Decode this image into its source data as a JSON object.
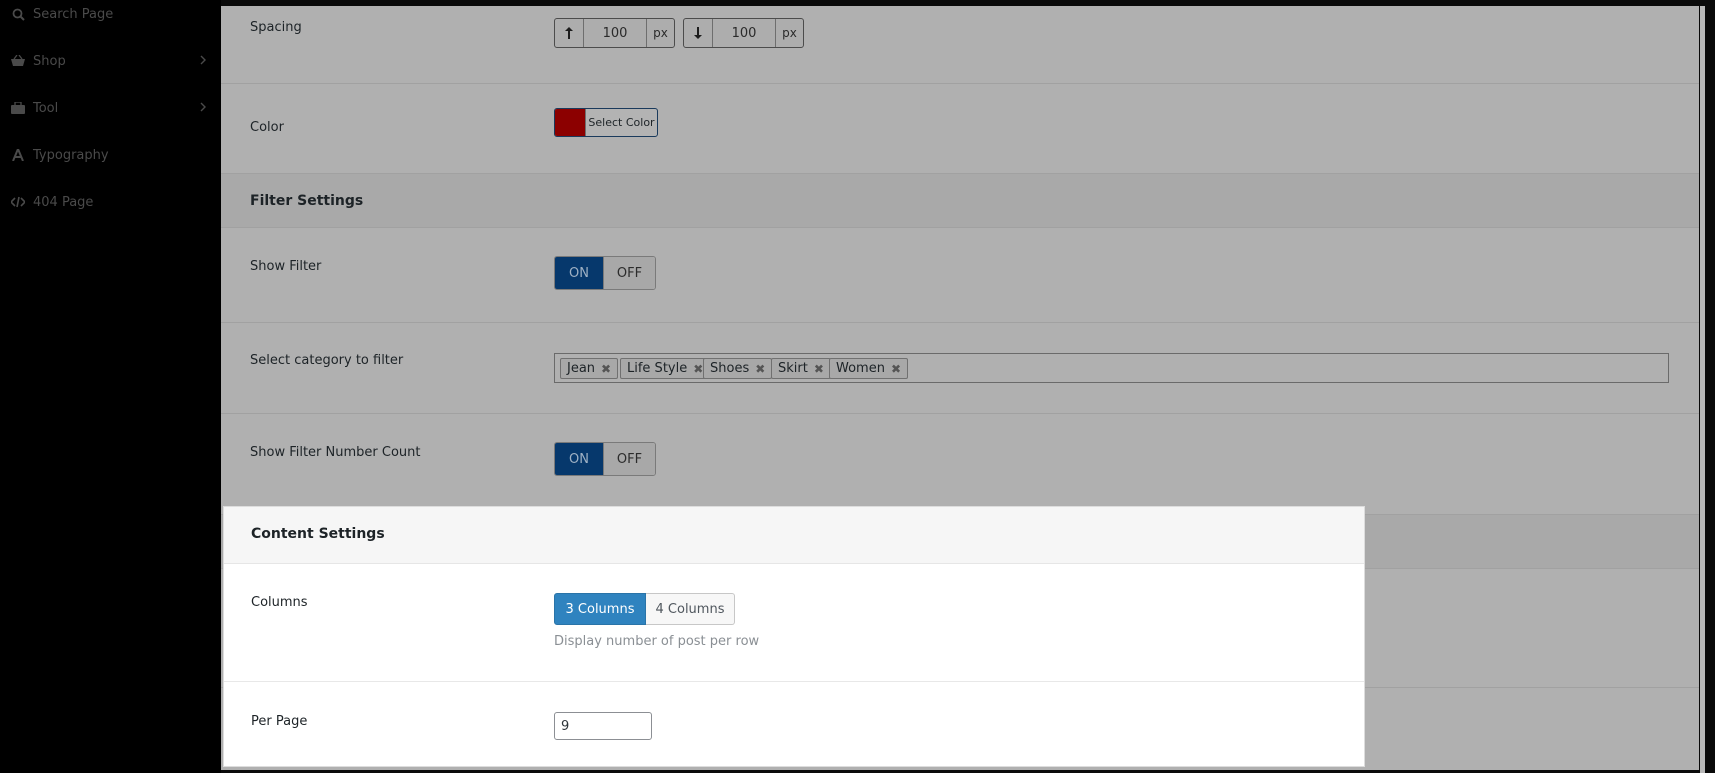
{
  "sidebar": {
    "items": [
      {
        "label": "Search Page",
        "icon": "search-icon"
      },
      {
        "label": "Shop",
        "icon": "basket-icon",
        "has_submenu": true
      },
      {
        "label": "Tool",
        "icon": "toolbox-icon",
        "has_submenu": true
      },
      {
        "label": "Typography",
        "icon": "typography-icon"
      },
      {
        "label": "404 Page",
        "icon": "code-icon"
      }
    ]
  },
  "settings": {
    "spacing": {
      "label": "Spacing",
      "top_value": "100",
      "bottom_value": "100",
      "unit": "px"
    },
    "color": {
      "label": "Color",
      "button_label": "Select Color",
      "value": "#8c0000"
    },
    "filter_section": {
      "title": "Filter Settings"
    },
    "show_filter": {
      "label": "Show Filter",
      "on": "ON",
      "off": "OFF",
      "state": "ON"
    },
    "select_category": {
      "label": "Select category to filter",
      "tags": [
        "Jean",
        "Life Style",
        "Shoes",
        "Skirt",
        "Women"
      ],
      "remove_glyph": "✖"
    },
    "show_filter_count": {
      "label": "Show Filter Number Count",
      "on": "ON",
      "off": "OFF",
      "state": "ON"
    },
    "content_section": {
      "title": "Content Settings"
    },
    "columns": {
      "label": "Columns",
      "options": [
        "3 Columns",
        "4 Columns"
      ],
      "selected": "3 Columns",
      "description": "Display number of post per row"
    },
    "per_page": {
      "label": "Per Page",
      "value": "9"
    }
  },
  "colors": {
    "toggle_on_bg": "#06386c",
    "active_button_bg": "#2f83bf",
    "overlay_bg": "#b0b0b0"
  }
}
